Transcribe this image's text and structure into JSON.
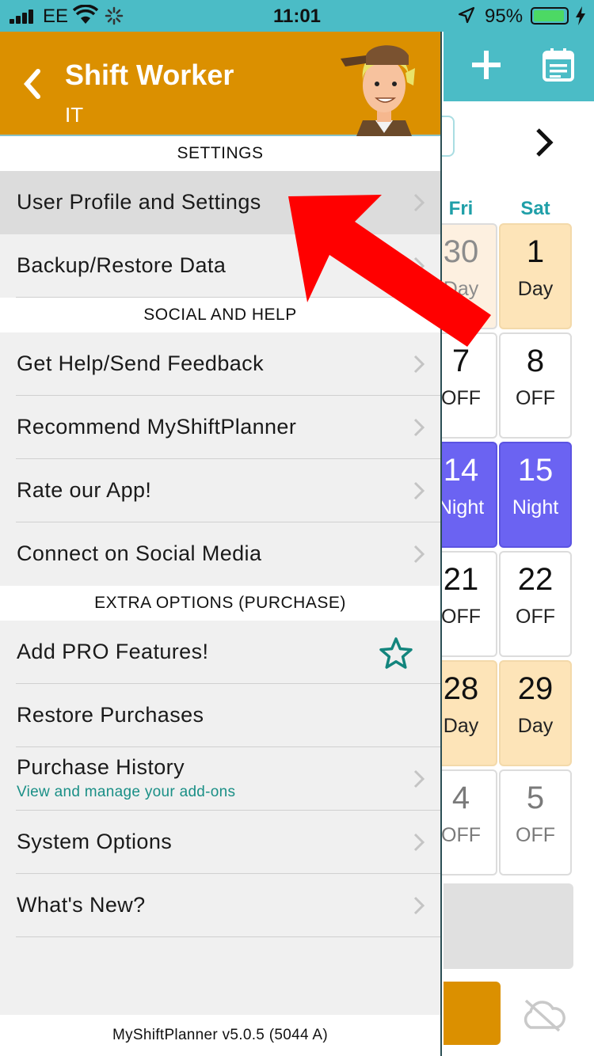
{
  "status_bar": {
    "carrier": "EE",
    "time": "11:01",
    "battery_percent": "95%",
    "battery_level": 0.95,
    "icons": [
      "signal-icon",
      "wifi-icon",
      "activity-spinner-icon",
      "location-arrow-icon",
      "battery-icon",
      "charging-bolt-icon"
    ]
  },
  "drawer": {
    "title": "Shift Worker",
    "subtitle": "IT",
    "sections": {
      "settings": "SETTINGS",
      "social": "SOCIAL AND HELP",
      "extra": "EXTRA OPTIONS (PURCHASE)"
    },
    "items": {
      "user_profile": "User Profile and Settings",
      "backup": "Backup/Restore Data",
      "help": "Get Help/Send Feedback",
      "recommend": "Recommend MyShiftPlanner",
      "rate": "Rate our App!",
      "social": "Connect on Social Media",
      "pro": "Add PRO Features!",
      "restore": "Restore Purchases",
      "history": "Purchase History",
      "history_sub": "View and manage your add-ons",
      "system": "System Options",
      "whats_new": "What's New?"
    },
    "footer": "MyShiftPlanner v5.0.5 (5044 A)"
  },
  "calendar": {
    "headers": {
      "fri": "Fri",
      "sat": "Sat"
    },
    "cells": {
      "c0": {
        "num": "30",
        "lbl": "Day"
      },
      "c1": {
        "num": "1",
        "lbl": "Day"
      },
      "c2": {
        "num": "7",
        "lbl": "OFF"
      },
      "c3": {
        "num": "8",
        "lbl": "OFF"
      },
      "c4": {
        "num": "14",
        "lbl": "Night"
      },
      "c5": {
        "num": "15",
        "lbl": "Night"
      },
      "c6": {
        "num": "21",
        "lbl": "OFF"
      },
      "c7": {
        "num": "22",
        "lbl": "OFF"
      },
      "c8": {
        "num": "28",
        "lbl": "Day"
      },
      "c9": {
        "num": "29",
        "lbl": "Day"
      },
      "c10": {
        "num": "4",
        "lbl": "OFF"
      },
      "c11": {
        "num": "5",
        "lbl": "OFF"
      }
    }
  },
  "colors": {
    "teal": "#4bbcc6",
    "orange": "#db9000",
    "night": "#6b63f2",
    "day": "#fde4b8",
    "accent_text": "#1a8f86",
    "annotation_red": "#ff0000"
  }
}
